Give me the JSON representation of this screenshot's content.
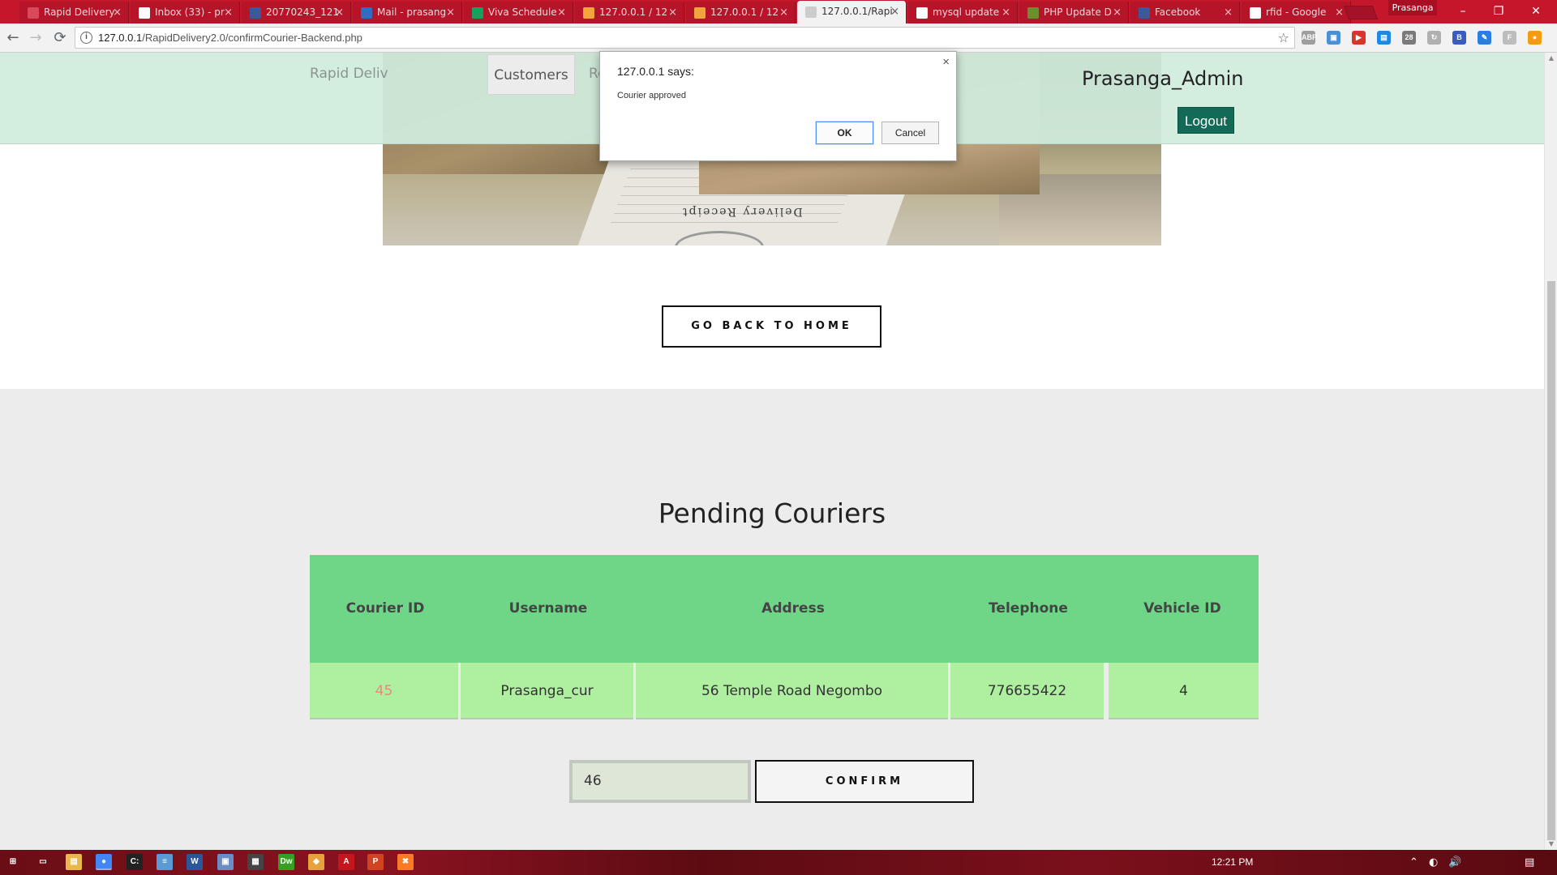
{
  "browser": {
    "tabs": [
      {
        "title": "Rapid Delivery",
        "icon": "document-icon",
        "color": "#d64a5c"
      },
      {
        "title": "Inbox (33) - pr",
        "icon": "gmail-icon",
        "color": "#ffffff"
      },
      {
        "title": "20770243_121",
        "icon": "facebook-icon",
        "color": "#3b5998"
      },
      {
        "title": "Mail - prasang",
        "icon": "outlook-icon",
        "color": "#2f6ec2"
      },
      {
        "title": "Viva Schedule",
        "icon": "sheets-icon",
        "color": "#18a05e"
      },
      {
        "title": "127.0.0.1 / 12",
        "icon": "phpmyadmin-icon",
        "color": "#f3a43a"
      },
      {
        "title": "127.0.0.1 / 12",
        "icon": "phpmyadmin-icon",
        "color": "#f3a43a"
      },
      {
        "title": "127.0.0.1/Rapi",
        "icon": "page-icon",
        "color": "#cccccc",
        "active": true
      },
      {
        "title": "mysql update",
        "icon": "google-icon",
        "color": "#ffffff"
      },
      {
        "title": "PHP Update D",
        "icon": "w3schools-icon",
        "color": "#6c8f2d"
      },
      {
        "title": "Facebook",
        "icon": "facebook-icon",
        "color": "#3b5998"
      },
      {
        "title": "rfid - Google",
        "icon": "google-icon",
        "color": "#ffffff"
      }
    ],
    "profile_name": "Prasanga",
    "url_host": "127.0.0.1",
    "url_path": "/RapidDelivery2.0/confirmCourier-Backend.php",
    "extensions": [
      {
        "icon": "abp-icon",
        "label": "ABP",
        "color": "#9e9e9e"
      },
      {
        "icon": "screen-icon",
        "label": "▣",
        "color": "#4a90d9"
      },
      {
        "icon": "video-icon",
        "label": "▶",
        "color": "#d9352a"
      },
      {
        "icon": "calendar-icon",
        "label": "▤",
        "color": "#1e88e5"
      },
      {
        "icon": "people-icon",
        "label": "28",
        "color": "#7a7a7a"
      },
      {
        "icon": "refresh-ext-icon",
        "label": "↻",
        "color": "#b0b0b0"
      },
      {
        "icon": "b-icon",
        "label": "B",
        "color": "#3a5bbf"
      },
      {
        "icon": "edit-ext-icon",
        "label": "✎",
        "color": "#2a7de1"
      },
      {
        "icon": "f-icon",
        "label": "F",
        "color": "#bdbdbd"
      },
      {
        "icon": "orange-ext-icon",
        "label": "●",
        "color": "#f39c12"
      }
    ]
  },
  "header": {
    "nav_items": [
      "Rapid Deliv",
      "Customers",
      "Re"
    ],
    "admin_name": "Prasanga_Admin",
    "logout_label": "Logout"
  },
  "hero": {
    "receipt_text": "Delivery Receipt"
  },
  "main": {
    "go_home_label": "GO BACK TO HOME",
    "pending_title": "Pending Couriers",
    "table": {
      "columns": [
        "Courier ID",
        "Username",
        "Address",
        "Telephone",
        "Vehicle ID"
      ],
      "rows": [
        [
          "45",
          "Prasanga_cur",
          "56 Temple Road Negombo",
          "776655422",
          "4"
        ]
      ]
    },
    "courier_input_value": "46",
    "confirm_label": "CONFIRM"
  },
  "dialog": {
    "title": "127.0.0.1 says:",
    "message": "Courier approved",
    "ok_label": "OK",
    "cancel_label": "Cancel"
  },
  "taskbar": {
    "apps": [
      {
        "icon": "windows-start-icon",
        "label": "⊞",
        "color": "transparent"
      },
      {
        "icon": "task-view-icon",
        "label": "▭",
        "color": "transparent"
      },
      {
        "icon": "file-explorer-icon",
        "label": "▤",
        "color": "#e8b84a"
      },
      {
        "icon": "chrome-icon",
        "label": "●",
        "color": "#4285f4"
      },
      {
        "icon": "terminal-icon",
        "label": "C:",
        "color": "#222222"
      },
      {
        "icon": "notepad-icon",
        "label": "≡",
        "color": "#5b9bd5"
      },
      {
        "icon": "word-icon",
        "label": "W",
        "color": "#2b579a"
      },
      {
        "icon": "photos-icon",
        "label": "▣",
        "color": "#6b8cc4"
      },
      {
        "icon": "calculator-icon",
        "label": "▦",
        "color": "#444444"
      },
      {
        "icon": "dreamweaver-icon",
        "label": "Dw",
        "color": "#35a022"
      },
      {
        "icon": "git-icon",
        "label": "◆",
        "color": "#e6a23c"
      },
      {
        "icon": "acrobat-icon",
        "label": "A",
        "color": "#c4161c"
      },
      {
        "icon": "powerpoint-icon",
        "label": "P",
        "color": "#d04423"
      },
      {
        "icon": "xampp-icon",
        "label": "✖",
        "color": "#fb7a24"
      }
    ],
    "time": "12:21 PM"
  }
}
